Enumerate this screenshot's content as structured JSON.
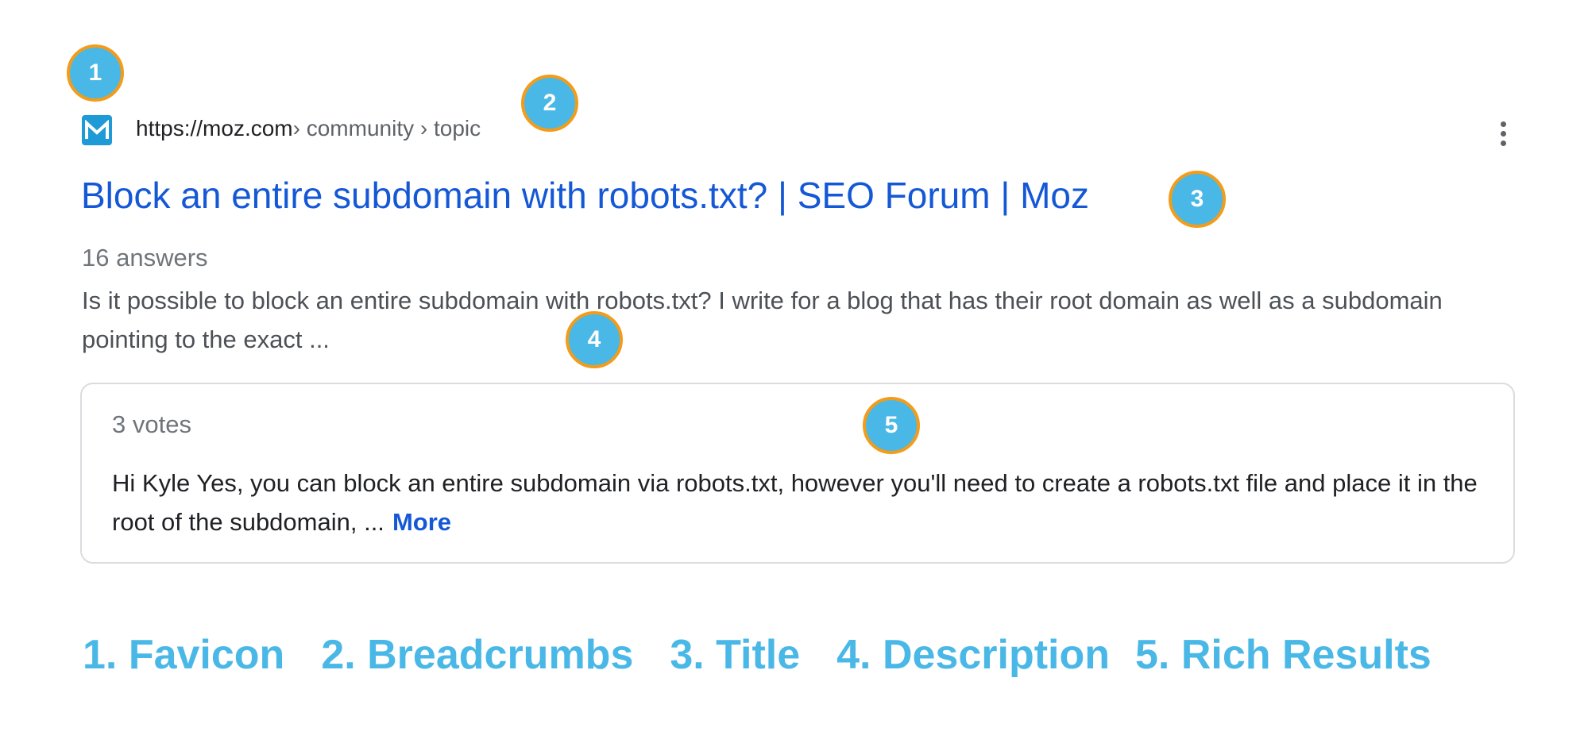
{
  "result": {
    "breadcrumb": {
      "domain": "https://moz.com",
      "path": " › community › topic"
    },
    "title": "Block an entire subdomain with robots.txt? | SEO Forum | Moz",
    "answers": "16 answers",
    "description": "Is it possible to block an entire subdomain with robots.txt? I write for a blog that has their root domain as well as a subdomain pointing to the exact ...",
    "rich_result": {
      "votes": "3 votes",
      "snippet": "Hi Kyle Yes, you can block an entire subdomain via robots.txt, however you'll need to create a robots.txt file and place it in the root of the subdomain, ...",
      "more_label": "More"
    }
  },
  "markers": [
    "1",
    "2",
    "3",
    "4",
    "5"
  ],
  "legend": {
    "items": [
      "1. Favicon",
      "2. Breadcrumbs",
      "3. Title",
      "4. Description",
      "5. Rich Results"
    ]
  },
  "colors": {
    "link": "#1558d6",
    "marker_fill": "#4ab8e6",
    "marker_border": "#f39c1a",
    "legend_text": "#4ab8e6",
    "favicon_bg": "#1e9ad6"
  },
  "icons": {
    "favicon": "moz-m-icon",
    "menu": "more-vert-icon"
  }
}
